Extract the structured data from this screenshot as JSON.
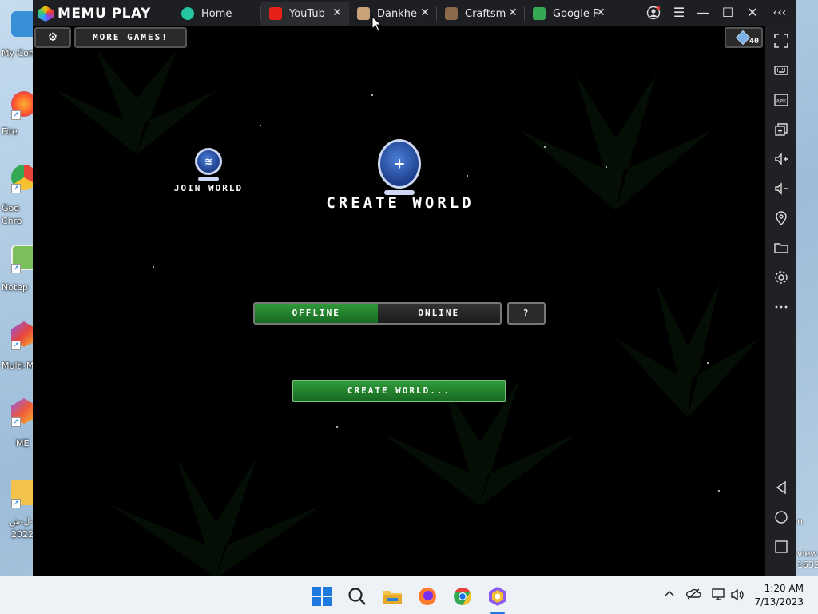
{
  "desktop": {
    "icons": [
      {
        "label": "My Com",
        "color": "#3a8fd9"
      },
      {
        "label": "Fire",
        "color": "#ff6d2e"
      },
      {
        "label": "Goo",
        "label2": "Chro",
        "color": "#e8443a"
      },
      {
        "label": "Notep",
        "color": "#7bbf5a"
      },
      {
        "label": "Multi-M",
        "color": "#8a5cf0"
      },
      {
        "label": "ME",
        "color": "#f05a3a"
      },
      {
        "label": "ل-ش-",
        "label2": "2022",
        "color": "#f2c24a"
      }
    ],
    "right_fragments": {
      "n": "n",
      "view": "view",
      "num": "1632"
    }
  },
  "emulator": {
    "app_name": "MEMU PLAY",
    "tabs": [
      {
        "label": "Home",
        "icon_color": "#25c7a0",
        "closable": false
      },
      {
        "label": "YouTub",
        "icon_color": "#e62117",
        "closable": true
      },
      {
        "label": "Dankhe",
        "icon_color": "#c9a27a",
        "closable": true
      },
      {
        "label": "Craftsm",
        "icon_color": "#8a6a4a",
        "closable": true
      },
      {
        "label": "Google F",
        "icon_color": "#34a853",
        "closable": true
      }
    ],
    "window_controls": {
      "account": "account-icon",
      "menu": "menu-icon",
      "minimize": "minimize-icon",
      "maximize": "maximize-icon",
      "close": "close-icon",
      "collapse": "collapse-icon"
    }
  },
  "game": {
    "settings_icon": "gear-icon",
    "more_games_label": "MORE GAMES!",
    "fps_value": "40",
    "join_world_label": "JOIN WORLD",
    "create_world_title": "CREATE WORLD",
    "mode": {
      "offline": "OFFLINE",
      "online": "ONLINE",
      "selected": "OFFLINE"
    },
    "help_label": "?",
    "create_world_button": "CREATE WORLD..."
  },
  "sidebar": {
    "buttons": [
      "fullscreen-icon",
      "keyboard-icon",
      "apk-icon",
      "multi-window-icon",
      "volume-up-icon",
      "volume-down-icon",
      "location-icon",
      "folder-icon",
      "settings-icon",
      "more-icon",
      "back-icon",
      "home-icon",
      "recents-icon"
    ],
    "apk_text": "APK"
  },
  "taskbar": {
    "apps": [
      "windows-start-icon",
      "search-icon",
      "file-explorer-icon",
      "firefox-icon",
      "chrome-icon",
      "memu-icon"
    ],
    "tray": [
      "chevron-up-icon",
      "onedrive-icon",
      "network-icon",
      "volume-icon"
    ],
    "time": "1:20 AM",
    "date": "7/13/2023"
  },
  "colors": {
    "green": "#2f9a3a",
    "titlebar": "#1e1f22",
    "sidebar": "#202124"
  }
}
